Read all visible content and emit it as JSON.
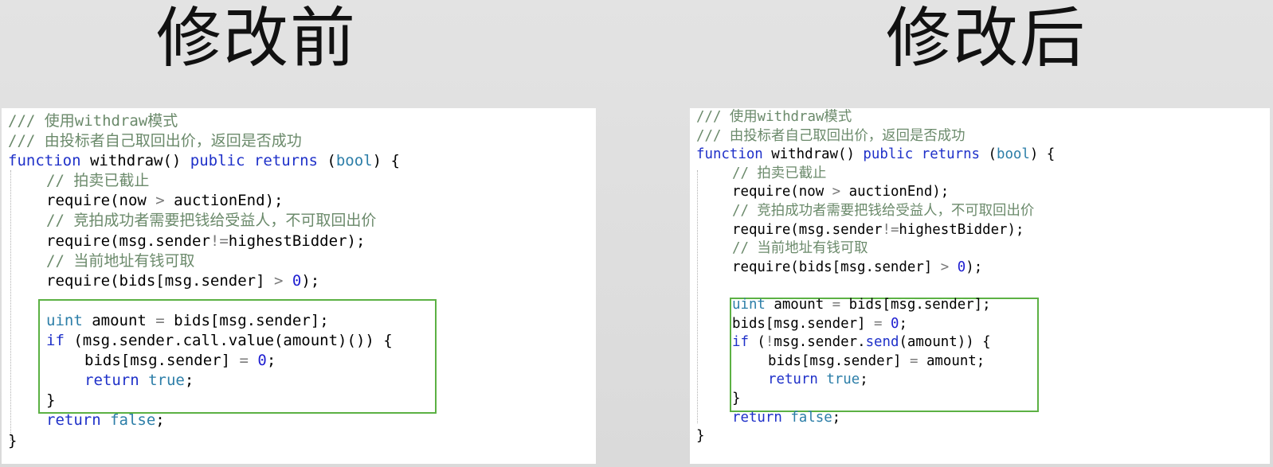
{
  "headings": {
    "before": "修改前",
    "after": "修改后"
  },
  "colors": {
    "background": "#dcdcdc",
    "panel": "#ffffff",
    "comment": "#6b8a6b",
    "keyword": "#1f31c9",
    "type": "#2c7ea8",
    "number": "#1f1fd1",
    "highlight_border": "#5cb144"
  },
  "panels": {
    "before": {
      "lines": [
        {
          "indent": 0,
          "tokens": [
            {
              "t": "comment",
              "v": "/// 使用withdraw模式"
            }
          ]
        },
        {
          "indent": 0,
          "tokens": [
            {
              "t": "comment",
              "v": "/// 由投标者自己取回出价，返回是否成功"
            }
          ]
        },
        {
          "indent": 0,
          "tokens": [
            {
              "t": "keyword",
              "v": "function"
            },
            {
              "t": "text",
              "v": " withdraw() "
            },
            {
              "t": "keyword",
              "v": "public"
            },
            {
              "t": "text",
              "v": " "
            },
            {
              "t": "keyword",
              "v": "returns"
            },
            {
              "t": "text",
              "v": " ("
            },
            {
              "t": "type",
              "v": "bool"
            },
            {
              "t": "text",
              "v": ") {"
            }
          ]
        },
        {
          "indent": 1,
          "tokens": [
            {
              "t": "comment",
              "v": "// 拍卖已截止"
            }
          ]
        },
        {
          "indent": 1,
          "tokens": [
            {
              "t": "text",
              "v": "require(now "
            },
            {
              "t": "op",
              "v": ">"
            },
            {
              "t": "text",
              "v": " auctionEnd);"
            }
          ]
        },
        {
          "indent": 1,
          "tokens": [
            {
              "t": "comment",
              "v": "// 竞拍成功者需要把钱给受益人，不可取回出价"
            }
          ]
        },
        {
          "indent": 1,
          "tokens": [
            {
              "t": "text",
              "v": "require(msg.sender"
            },
            {
              "t": "op",
              "v": "!="
            },
            {
              "t": "text",
              "v": "highestBidder);"
            }
          ]
        },
        {
          "indent": 1,
          "tokens": [
            {
              "t": "comment",
              "v": "// 当前地址有钱可取"
            }
          ]
        },
        {
          "indent": 1,
          "tokens": [
            {
              "t": "text",
              "v": "require(bids[msg.sender] "
            },
            {
              "t": "op",
              "v": ">"
            },
            {
              "t": "text",
              "v": " "
            },
            {
              "t": "number",
              "v": "0"
            },
            {
              "t": "text",
              "v": ");"
            }
          ]
        },
        {
          "indent": 0,
          "tokens": []
        },
        {
          "indent": 1,
          "tokens": [
            {
              "t": "type",
              "v": "uint"
            },
            {
              "t": "text",
              "v": " amount "
            },
            {
              "t": "op",
              "v": "="
            },
            {
              "t": "text",
              "v": " bids[msg.sender];"
            }
          ]
        },
        {
          "indent": 1,
          "tokens": [
            {
              "t": "keyword",
              "v": "if"
            },
            {
              "t": "text",
              "v": " (msg.sender.call.value(amount)()) {"
            }
          ]
        },
        {
          "indent": 2,
          "tokens": [
            {
              "t": "text",
              "v": "bids[msg.sender] "
            },
            {
              "t": "op",
              "v": "="
            },
            {
              "t": "text",
              "v": " "
            },
            {
              "t": "number",
              "v": "0"
            },
            {
              "t": "text",
              "v": ";"
            }
          ]
        },
        {
          "indent": 2,
          "tokens": [
            {
              "t": "keyword",
              "v": "return"
            },
            {
              "t": "text",
              "v": " "
            },
            {
              "t": "type",
              "v": "true"
            },
            {
              "t": "text",
              "v": ";"
            }
          ]
        },
        {
          "indent": 1,
          "tokens": [
            {
              "t": "text",
              "v": "}"
            }
          ]
        },
        {
          "indent": 1,
          "tokens": [
            {
              "t": "keyword",
              "v": "return"
            },
            {
              "t": "text",
              "v": " "
            },
            {
              "t": "type",
              "v": "false"
            },
            {
              "t": "text",
              "v": ";"
            }
          ]
        },
        {
          "indent": 0,
          "tokens": [
            {
              "t": "text",
              "v": "}"
            }
          ]
        }
      ]
    },
    "after": {
      "lines": [
        {
          "indent": 0,
          "tokens": [
            {
              "t": "comment",
              "v": "/// 使用withdraw模式"
            }
          ]
        },
        {
          "indent": 0,
          "tokens": [
            {
              "t": "comment",
              "v": "/// 由投标者自己取回出价，返回是否成功"
            }
          ]
        },
        {
          "indent": 0,
          "tokens": [
            {
              "t": "keyword",
              "v": "function"
            },
            {
              "t": "text",
              "v": " withdraw() "
            },
            {
              "t": "keyword",
              "v": "public"
            },
            {
              "t": "text",
              "v": " "
            },
            {
              "t": "keyword",
              "v": "returns"
            },
            {
              "t": "text",
              "v": " ("
            },
            {
              "t": "type",
              "v": "bool"
            },
            {
              "t": "text",
              "v": ") {"
            }
          ]
        },
        {
          "indent": 1,
          "tokens": [
            {
              "t": "comment",
              "v": "// 拍卖已截止"
            }
          ]
        },
        {
          "indent": 1,
          "tokens": [
            {
              "t": "text",
              "v": "require(now "
            },
            {
              "t": "op",
              "v": ">"
            },
            {
              "t": "text",
              "v": " auctionEnd);"
            }
          ]
        },
        {
          "indent": 1,
          "tokens": [
            {
              "t": "comment",
              "v": "// 竞拍成功者需要把钱给受益人，不可取回出价"
            }
          ]
        },
        {
          "indent": 1,
          "tokens": [
            {
              "t": "text",
              "v": "require(msg.sender"
            },
            {
              "t": "op",
              "v": "!="
            },
            {
              "t": "text",
              "v": "highestBidder);"
            }
          ]
        },
        {
          "indent": 1,
          "tokens": [
            {
              "t": "comment",
              "v": "// 当前地址有钱可取"
            }
          ]
        },
        {
          "indent": 1,
          "tokens": [
            {
              "t": "text",
              "v": "require(bids[msg.sender] "
            },
            {
              "t": "op",
              "v": ">"
            },
            {
              "t": "text",
              "v": " "
            },
            {
              "t": "number",
              "v": "0"
            },
            {
              "t": "text",
              "v": ");"
            }
          ]
        },
        {
          "indent": 0,
          "tokens": []
        },
        {
          "indent": 1,
          "tokens": [
            {
              "t": "type",
              "v": "uint"
            },
            {
              "t": "text",
              "v": " amount "
            },
            {
              "t": "op",
              "v": "="
            },
            {
              "t": "text",
              "v": " bids[msg.sender];"
            }
          ]
        },
        {
          "indent": 1,
          "tokens": [
            {
              "t": "text",
              "v": "bids[msg.sender] "
            },
            {
              "t": "op",
              "v": "="
            },
            {
              "t": "text",
              "v": " "
            },
            {
              "t": "number",
              "v": "0"
            },
            {
              "t": "text",
              "v": ";"
            }
          ]
        },
        {
          "indent": 1,
          "tokens": [
            {
              "t": "keyword",
              "v": "if"
            },
            {
              "t": "text",
              "v": " ("
            },
            {
              "t": "op",
              "v": "!"
            },
            {
              "t": "text",
              "v": "msg.sender."
            },
            {
              "t": "keyword",
              "v": "send"
            },
            {
              "t": "text",
              "v": "(amount)) {"
            }
          ]
        },
        {
          "indent": 2,
          "tokens": [
            {
              "t": "text",
              "v": "bids[msg.sender] "
            },
            {
              "t": "op",
              "v": "="
            },
            {
              "t": "text",
              "v": " amount;"
            }
          ]
        },
        {
          "indent": 2,
          "tokens": [
            {
              "t": "keyword",
              "v": "return"
            },
            {
              "t": "text",
              "v": " "
            },
            {
              "t": "type",
              "v": "true"
            },
            {
              "t": "text",
              "v": ";"
            }
          ]
        },
        {
          "indent": 1,
          "tokens": [
            {
              "t": "text",
              "v": "}"
            }
          ]
        },
        {
          "indent": 1,
          "tokens": [
            {
              "t": "keyword",
              "v": "return"
            },
            {
              "t": "text",
              "v": " "
            },
            {
              "t": "type",
              "v": "false"
            },
            {
              "t": "text",
              "v": ";"
            }
          ]
        },
        {
          "indent": 0,
          "tokens": [
            {
              "t": "text",
              "v": "}"
            }
          ]
        }
      ]
    }
  }
}
